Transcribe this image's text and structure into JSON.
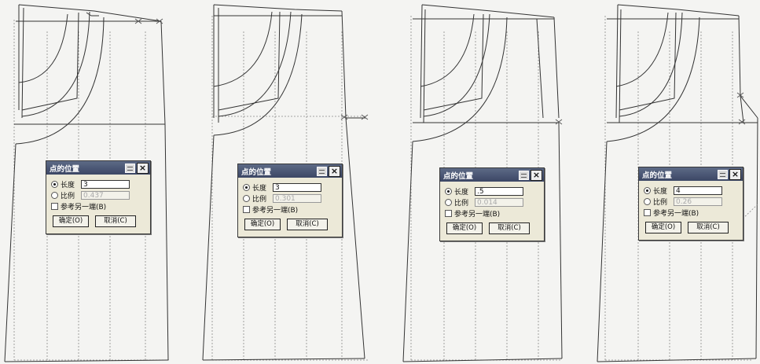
{
  "dialogs": [
    {
      "title": "点的位置",
      "length_label": "长度",
      "length_value": "3",
      "ratio_label": "比例",
      "ratio_value": "0.437",
      "ref_label": "参考另一端(B)",
      "ok_label": "确定(O)",
      "cancel_label": "取消(C)",
      "length_selected": true
    },
    {
      "title": "点的位置",
      "length_label": "长度",
      "length_value": "3",
      "ratio_label": "比例",
      "ratio_value": "0.301",
      "ref_label": "参考另一端(B)",
      "ok_label": "确定(O)",
      "cancel_label": "取消(C)",
      "length_selected": true
    },
    {
      "title": "点的位置",
      "length_label": "长度",
      "length_value": ".5",
      "ratio_label": "比例",
      "ratio_value": "0.014",
      "ref_label": "参考另一端(B)",
      "ok_label": "确定(O)",
      "cancel_label": "取消(C)",
      "length_selected": true
    },
    {
      "title": "点的位置",
      "length_label": "长度",
      "length_value": "4",
      "ratio_label": "比例",
      "ratio_value": "0.26",
      "ref_label": "参考另一端(B)",
      "ok_label": "确定(O)",
      "cancel_label": "取消(C)",
      "length_selected": true
    }
  ],
  "icons": {
    "minimize": "minimize-icon",
    "close": "close-icon"
  },
  "colors": {
    "titlebar": "#3c4765",
    "dialog_bg": "#ece9d8",
    "line": "#333333"
  }
}
